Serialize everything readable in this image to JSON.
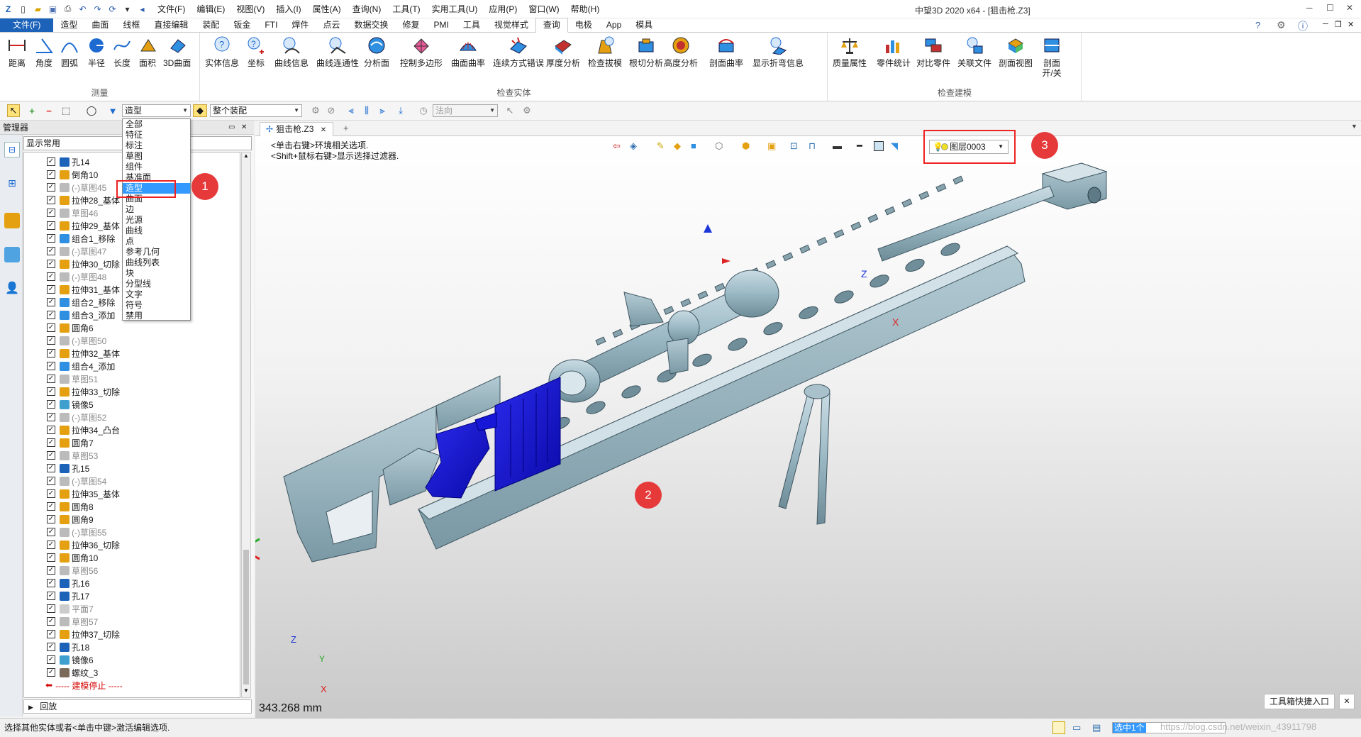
{
  "titlebar": {
    "menus": [
      "文件(F)",
      "编辑(E)",
      "视图(V)",
      "插入(I)",
      "属性(A)",
      "查询(N)",
      "工具(T)",
      "实用工具(U)",
      "应用(P)",
      "窗口(W)",
      "帮助(H)"
    ],
    "window_title": "中望3D 2020 x64 - [狙击枪.Z3]"
  },
  "ribbon_tabs": [
    "文件(F)",
    "造型",
    "曲面",
    "线框",
    "直接编辑",
    "装配",
    "钣金",
    "FTI",
    "焊件",
    "点云",
    "数据交换",
    "修复",
    "PMI",
    "工具",
    "视觉样式",
    "查询",
    "电极",
    "App",
    "模具"
  ],
  "ribbon_groups": {
    "measure": {
      "label": "测量",
      "buttons": [
        "距离",
        "角度",
        "圆弧",
        "半径",
        "长度",
        "面积",
        "3D曲面"
      ]
    },
    "inspect_entity": {
      "label": "检查实体",
      "buttons": [
        "实体信息",
        "坐标",
        "曲线信息",
        "曲线连通性",
        "分析面",
        "控制多边形",
        "曲面曲率",
        "连续方式错误",
        "厚度分析",
        "检查拔模",
        "根切分析",
        "高度分析",
        "剖面曲率",
        "显示折弯信息"
      ]
    },
    "inspect_model": {
      "label": "检查建模",
      "buttons": [
        "质量属性",
        "零件统计",
        "对比零件",
        "关联文件",
        "剖面视图",
        "剖面 开/关"
      ]
    }
  },
  "toolbar": {
    "filter_value": "造型",
    "scope_value": "整个装配",
    "direction_placeholder": "法向"
  },
  "manager": {
    "title": "管理器",
    "filter": "显示常用",
    "rollback": "回放",
    "tree": [
      {
        "label": "孔14",
        "dim": false,
        "icon": "hole"
      },
      {
        "label": "倒角10",
        "dim": false,
        "icon": "feature"
      },
      {
        "label": "(-)草图45",
        "dim": true,
        "icon": "sketch"
      },
      {
        "label": "拉伸28_基体",
        "dim": false,
        "icon": "feature"
      },
      {
        "label": "草图46",
        "dim": true,
        "icon": "sketch"
      },
      {
        "label": "拉伸29_基体",
        "dim": false,
        "icon": "feature"
      },
      {
        "label": "组合1_移除",
        "dim": false,
        "icon": "combine"
      },
      {
        "label": "(-)草图47",
        "dim": true,
        "icon": "sketch"
      },
      {
        "label": "拉伸30_切除",
        "dim": false,
        "icon": "feature"
      },
      {
        "label": "(-)草图48",
        "dim": true,
        "icon": "sketch"
      },
      {
        "label": "拉伸31_基体",
        "dim": false,
        "icon": "feature"
      },
      {
        "label": "组合2_移除",
        "dim": false,
        "icon": "combine"
      },
      {
        "label": "组合3_添加",
        "dim": false,
        "icon": "combine"
      },
      {
        "label": "圆角6",
        "dim": false,
        "icon": "feature"
      },
      {
        "label": "(-)草图50",
        "dim": true,
        "icon": "sketch"
      },
      {
        "label": "拉伸32_基体",
        "dim": false,
        "icon": "feature"
      },
      {
        "label": "组合4_添加",
        "dim": false,
        "icon": "combine"
      },
      {
        "label": "草图51",
        "dim": true,
        "icon": "sketch"
      },
      {
        "label": "拉伸33_切除",
        "dim": false,
        "icon": "feature"
      },
      {
        "label": "镜像5",
        "dim": false,
        "icon": "mirror"
      },
      {
        "label": "(-)草图52",
        "dim": true,
        "icon": "sketch"
      },
      {
        "label": "拉伸34_凸台",
        "dim": false,
        "icon": "feature"
      },
      {
        "label": "圆角7",
        "dim": false,
        "icon": "feature"
      },
      {
        "label": "草图53",
        "dim": true,
        "icon": "sketch"
      },
      {
        "label": "孔15",
        "dim": false,
        "icon": "hole"
      },
      {
        "label": "(-)草图54",
        "dim": true,
        "icon": "sketch"
      },
      {
        "label": "拉伸35_基体",
        "dim": false,
        "icon": "feature"
      },
      {
        "label": "圆角8",
        "dim": false,
        "icon": "feature"
      },
      {
        "label": "圆角9",
        "dim": false,
        "icon": "feature"
      },
      {
        "label": "(-)草图55",
        "dim": true,
        "icon": "sketch"
      },
      {
        "label": "拉伸36_切除",
        "dim": false,
        "icon": "feature"
      },
      {
        "label": "圆角10",
        "dim": false,
        "icon": "feature"
      },
      {
        "label": "草图56",
        "dim": true,
        "icon": "sketch"
      },
      {
        "label": "孔16",
        "dim": false,
        "icon": "hole"
      },
      {
        "label": "孔17",
        "dim": false,
        "icon": "hole"
      },
      {
        "label": "平面7",
        "dim": true,
        "icon": "plane"
      },
      {
        "label": "草图57",
        "dim": true,
        "icon": "sketch"
      },
      {
        "label": "拉伸37_切除",
        "dim": false,
        "icon": "feature"
      },
      {
        "label": "孔18",
        "dim": false,
        "icon": "hole"
      },
      {
        "label": "镜像6",
        "dim": false,
        "icon": "mirror"
      },
      {
        "label": "螺纹_3",
        "dim": false,
        "icon": "thread"
      }
    ],
    "stop_label": "----- 建模停止 -----"
  },
  "filter_dropdown": {
    "options": [
      "全部",
      "特征",
      "标注",
      "草图",
      "组件",
      "基准面",
      "造型",
      "曲面",
      "边",
      "光源",
      "曲线",
      "点",
      "参考几何",
      "曲线列表",
      "块",
      "分型线",
      "文字",
      "符号",
      "禁用"
    ],
    "selected": "造型"
  },
  "annotations": [
    "1",
    "2",
    "3"
  ],
  "viewport": {
    "doc_tab": "狙击枪.Z3",
    "hint_line1": "<单击右键>环境相关选项.",
    "hint_line2": "<Shift+鼠标右键>显示选择过滤器.",
    "layer": "图层0003",
    "measure": "343.268 mm",
    "axis_labels": {
      "x": "X",
      "y": "Y",
      "z": "Z"
    }
  },
  "status": {
    "message": "选择其他实体或者<单击中键>激活编辑选项.",
    "quick_entry": "工具箱快捷入口",
    "selection": "选中1个",
    "watermark": "https://blog.csdn.net/weixin_43911798"
  },
  "colors": {
    "model_gray": "#9ab8c4",
    "model_highlight": "#1414d0",
    "annotation_red": "#e63a3a",
    "file_tab_blue": "#1c62b9"
  }
}
